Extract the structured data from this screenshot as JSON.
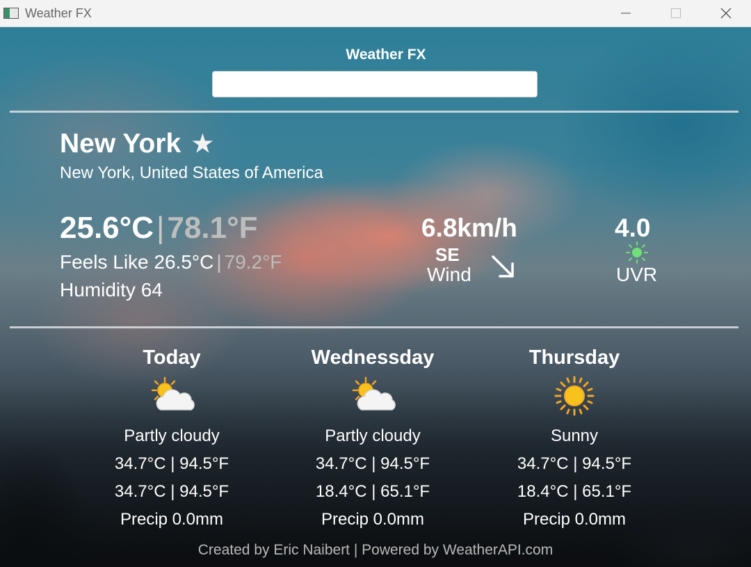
{
  "window": {
    "title": "Weather FX"
  },
  "header": {
    "title": "Weather FX",
    "search_value": ""
  },
  "current": {
    "city": "New York",
    "favorite_icon": "star-icon",
    "region": "New York, United States of America",
    "temp_c": "25.6°C",
    "temp_f": "78.1°F",
    "feels_like_label": "Feels Like",
    "feels_like_c": "26.5°C",
    "feels_like_f": "79.2°F",
    "humidity_label": "Humidity",
    "humidity": "64",
    "wind_speed": "6.8km/h",
    "wind_dir": "SE",
    "wind_label": "Wind",
    "wind_icon": "arrow-down-right-icon",
    "uv_value": "4.0",
    "uv_label": "UVR",
    "uv_icon": "sun-icon",
    "uv_color": "#6fe07a"
  },
  "forecast": [
    {
      "day": "Today",
      "icon": "partly-cloudy-icon",
      "condition": "Partly cloudy",
      "line1": "34.7°C | 94.5°F",
      "line2": "34.7°C | 94.5°F",
      "precip": "Precip 0.0mm"
    },
    {
      "day": "Wednessday",
      "icon": "partly-cloudy-icon",
      "condition": "Partly cloudy",
      "line1": "34.7°C | 94.5°F",
      "line2": "18.4°C | 65.1°F",
      "precip": "Precip 0.0mm"
    },
    {
      "day": "Thursday",
      "icon": "sunny-icon",
      "condition": "Sunny",
      "line1": "34.7°C | 94.5°F",
      "line2": "18.4°C | 65.1°F",
      "precip": "Precip 0.0mm"
    }
  ],
  "footer": {
    "text": "Created by Eric Naibert | Powered by WeatherAPI.com"
  }
}
